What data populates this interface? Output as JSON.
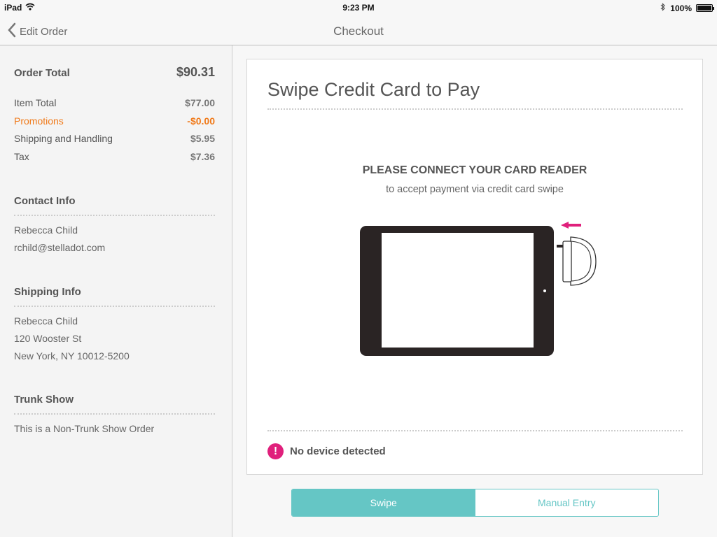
{
  "status_bar": {
    "device": "iPad",
    "time": "9:23 PM",
    "battery": "100%",
    "battery_level": 1.0,
    "icons": [
      "wifi-icon",
      "bluetooth-icon",
      "battery-icon"
    ]
  },
  "navbar": {
    "back_label": "Edit Order",
    "title": "Checkout"
  },
  "order": {
    "total_label": "Order Total",
    "total_value": "$90.31",
    "lines": [
      {
        "label": "Item Total",
        "value": "$77.00"
      },
      {
        "label": "Promotions",
        "value": "-$0.00"
      },
      {
        "label": "Shipping and Handling",
        "value": "$5.95"
      },
      {
        "label": "Tax",
        "value": "$7.36"
      }
    ]
  },
  "contact": {
    "title": "Contact Info",
    "lines": [
      "Rebecca Child",
      "rchild@stelladot.com"
    ]
  },
  "shipping": {
    "title": "Shipping Info",
    "lines": [
      "Rebecca Child",
      "120 Wooster St",
      "New York, NY 10012-5200"
    ]
  },
  "trunk_show": {
    "title": "Trunk Show",
    "lines": [
      "This is a Non-Trunk Show Order"
    ]
  },
  "card": {
    "title": "Swipe Credit Card to Pay",
    "connect_title": "PLEASE CONNECT YOUR CARD READER",
    "connect_subtitle": "to accept payment via credit card swipe",
    "status_text": "No device detected"
  },
  "segmented": {
    "swipe_label": "Swipe",
    "manual_label": "Manual Entry",
    "selected": "Swipe"
  },
  "colors": {
    "accent": "#65c6c5",
    "promo": "#f07a1a",
    "alert": "#e0207c"
  }
}
